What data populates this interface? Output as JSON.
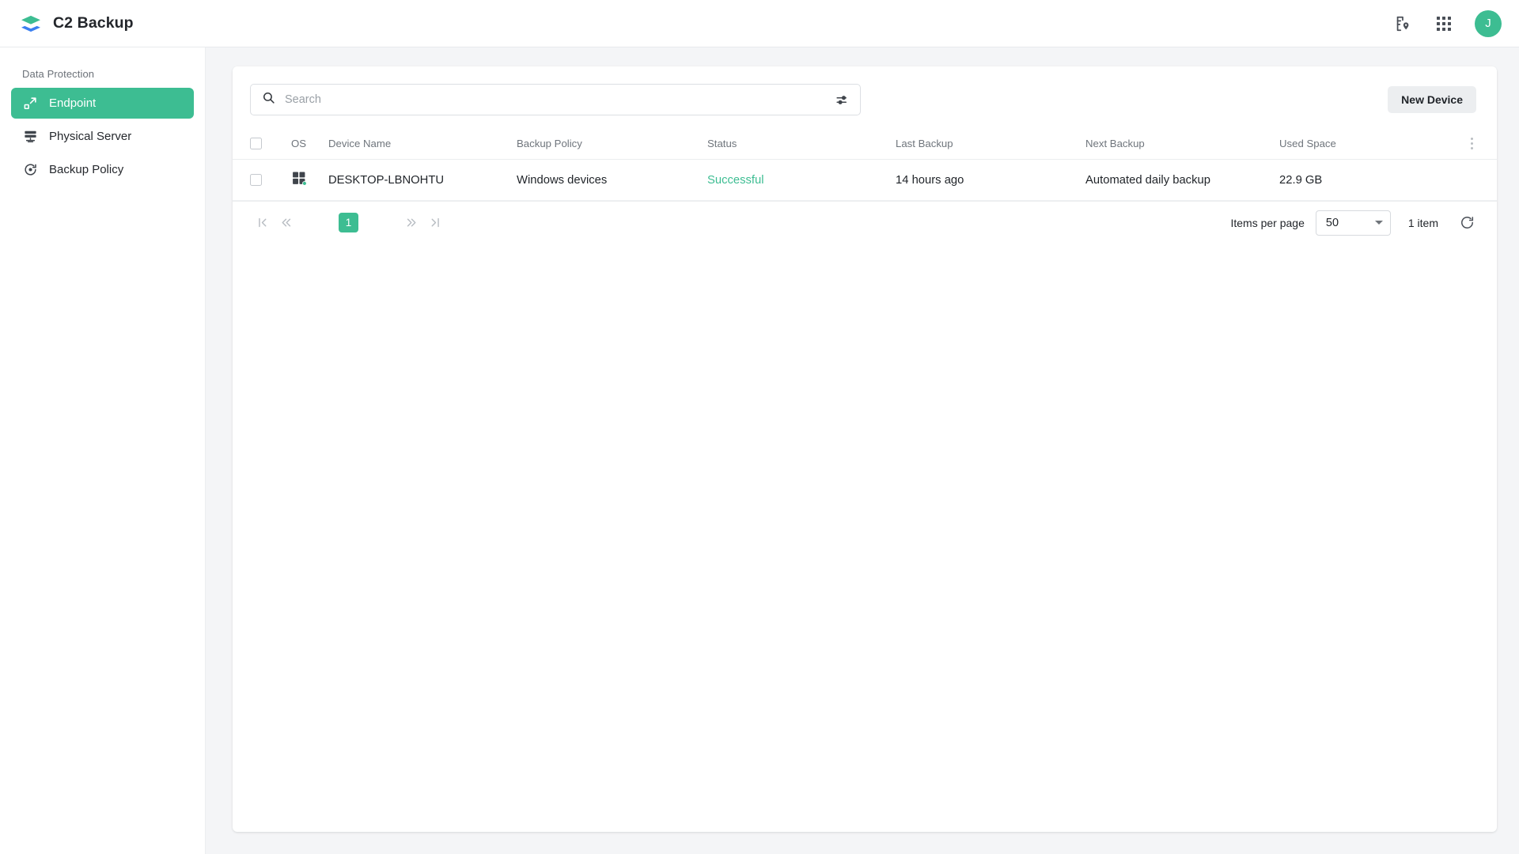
{
  "app": {
    "title": "C2 Backup",
    "logo_icon": "layers-icon",
    "accent_green": "#3dbd92",
    "logo_green": "#3dbd92",
    "logo_blue": "#3b7ff0"
  },
  "topbar": {
    "region_icon": "file-location-icon",
    "apps_icon": "apps-grid-icon",
    "avatar_initial": "J"
  },
  "sidebar": {
    "section_title": "Data Protection",
    "items": [
      {
        "label": "Endpoint",
        "icon": "endpoint-node-icon",
        "active": true
      },
      {
        "label": "Physical Server",
        "icon": "server-icon",
        "active": false
      },
      {
        "label": "Backup Policy",
        "icon": "policy-refresh-icon",
        "active": false
      }
    ]
  },
  "toolbar": {
    "search_placeholder": "Search",
    "search_value": "",
    "search_icon": "search-icon",
    "filter_icon": "filter-sliders-icon",
    "new_device_label": "New Device"
  },
  "table": {
    "columns": [
      "OS",
      "Device Name",
      "Backup Policy",
      "Status",
      "Last Backup",
      "Next Backup",
      "Used Space"
    ],
    "header_menu_icon": "more-vertical-icon",
    "rows": [
      {
        "os_icon": "windows-icon",
        "device_name": "DESKTOP-LBNOHTU",
        "backup_policy": "Windows devices",
        "status": "Successful",
        "status_color": "#3dbd92",
        "last_backup": "14 hours ago",
        "next_backup": "Automated daily backup",
        "used_space": "22.9 GB"
      }
    ]
  },
  "footer": {
    "first_page_icon": "first-page-icon",
    "prev_page_icon": "prev-page-icon",
    "current_page": "1",
    "next_page_icon": "next-page-icon",
    "last_page_icon": "last-page-icon",
    "items_per_page_label": "Items per page",
    "items_per_page_value": "50",
    "item_count": "1 item",
    "refresh_icon": "refresh-icon"
  }
}
